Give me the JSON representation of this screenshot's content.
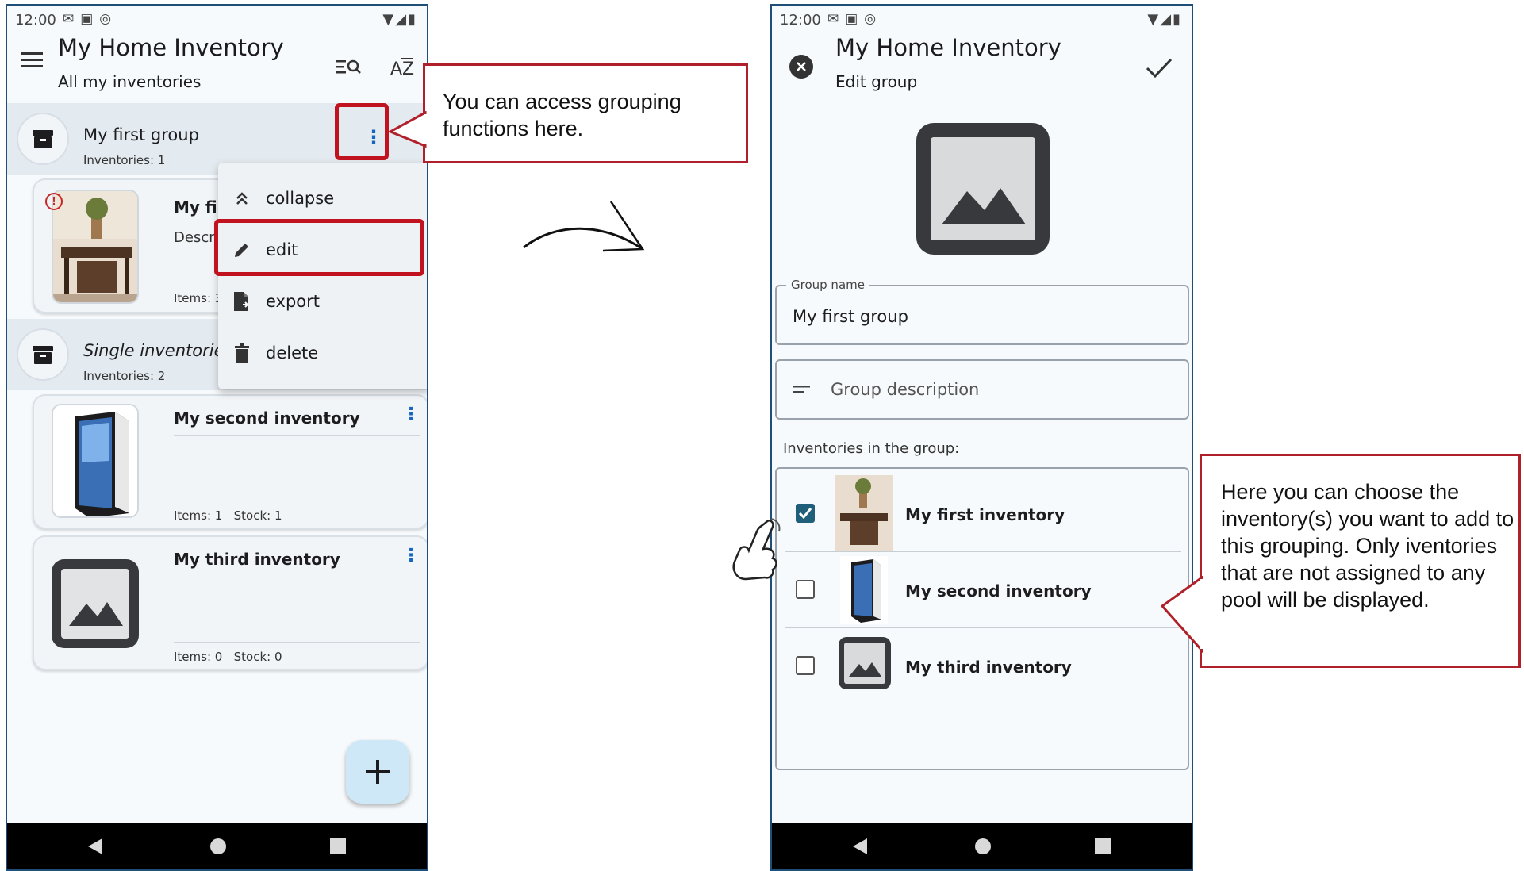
{
  "left_screen": {
    "status": {
      "time": "12:00"
    },
    "app_title": "My Home Inventory",
    "app_subtitle": "All my inventories",
    "groups": [
      {
        "title": "My first group",
        "subtitle": "Inventories: 1"
      },
      {
        "title": "Single inventories",
        "subtitle": "Inventories: 2"
      }
    ],
    "first_card": {
      "title": "My fir",
      "desc": "Descri",
      "meta": "Items: 3"
    },
    "cards": [
      {
        "title": "My second inventory",
        "meta": "Items: 1   Stock: 1"
      },
      {
        "title": "My third inventory",
        "meta": "Items: 0   Stock: 0"
      }
    ],
    "menu": [
      {
        "label": "collapse",
        "icon": "collapse-icon"
      },
      {
        "label": "edit",
        "icon": "pencil-icon"
      },
      {
        "label": "export",
        "icon": "export-file-icon"
      },
      {
        "label": "delete",
        "icon": "trash-icon"
      }
    ]
  },
  "right_screen": {
    "status": {
      "time": "12:00"
    },
    "app_title": "My Home Inventory",
    "app_subtitle": "Edit group",
    "group_name_label": "Group name",
    "group_name_value": "My first group",
    "group_description_placeholder": "Group description",
    "inventories_heading": "Inventories in the group:",
    "inventories": [
      {
        "title": "My first inventory",
        "checked": true
      },
      {
        "title": "My second inventory",
        "checked": false
      },
      {
        "title": "My third inventory",
        "checked": false
      }
    ]
  },
  "callouts": {
    "grouping": "You can access grouping functions here.",
    "choose": "Here you can choose the inventory(s) you want to add to this grouping. Only iventories that are not assigned to any pool will be displayed."
  },
  "colors": {
    "accent": "#1565c0",
    "callout_border": "#b0202a",
    "highlight": "#c1121f",
    "check": "#1f5f7a"
  }
}
